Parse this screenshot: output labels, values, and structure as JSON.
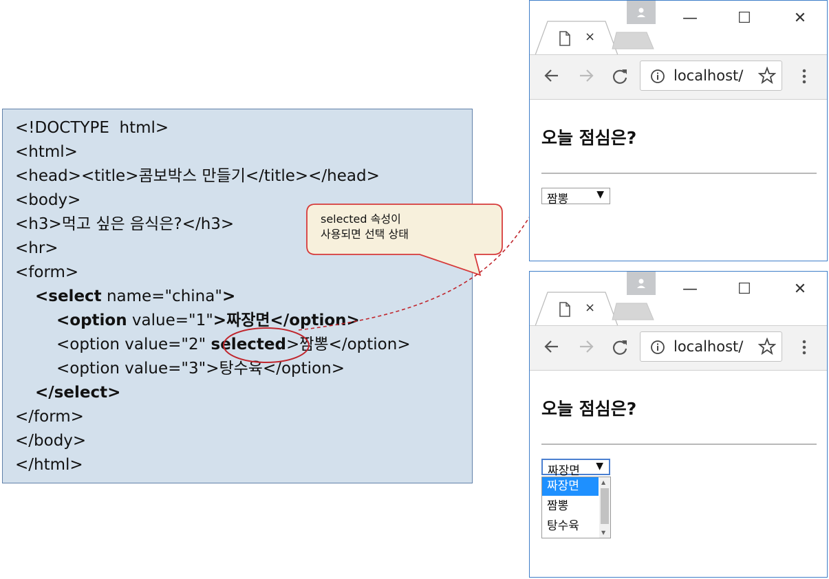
{
  "code": {
    "lines": [
      "<!DOCTYPE  html>",
      "<html>",
      "<head><title>콤보박스 만들기</title></head>",
      "<body>",
      "<h3>먹고 싶은 음식은?</h3>",
      "<hr>",
      "<form>",
      "<select",
      " name=\"china\"",
      ">",
      "<option",
      " value=\"1\"",
      ">짜장면</option>",
      "<option value=\"2\" ",
      "selected",
      ">짬뽕</option>",
      "<option value=\"3\">탕수육</option>",
      "</select>",
      "</form>",
      "</body>",
      "</html>"
    ]
  },
  "callout": {
    "line1": "selected 속성이",
    "line2": "사용되면 선택 상태"
  },
  "browser_top": {
    "url": "localhost/",
    "heading": "오늘 점심은?",
    "select_value": "짬뽕",
    "select_arrow": "▼"
  },
  "browser_bottom": {
    "url": "localhost/",
    "heading": "오늘 점심은?",
    "select_value": "짜장면",
    "select_arrow": "▼",
    "options": [
      "짜장면",
      "짬뽕",
      "탕수육"
    ],
    "highlighted_option": "짜장면"
  },
  "window_controls": {
    "minimize": "—",
    "maximize": "☐",
    "close": "✕",
    "tab_close": "×"
  },
  "colors": {
    "code_panel_bg": "#d3e0ec",
    "callout_bg": "#f7f0dc",
    "callout_border": "#d63a3a",
    "highlight_oval": "#c0262d",
    "arrow": "#c0262d",
    "selected_option": "#1e90ff",
    "browser_border": "#3d7dc8"
  }
}
